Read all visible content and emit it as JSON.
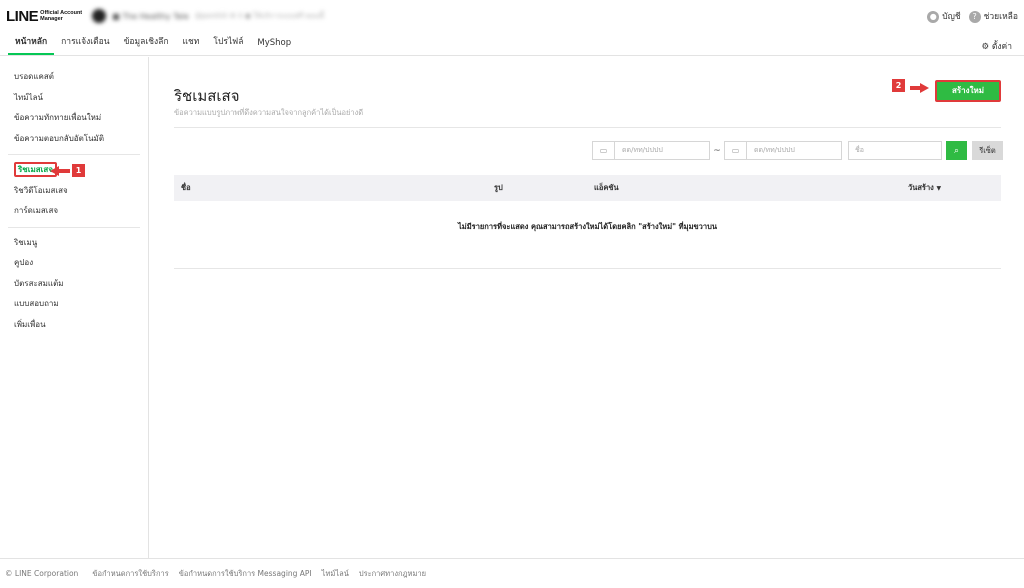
{
  "header": {
    "logo_main": "LINE",
    "logo_sub_1": "Official Account",
    "logo_sub_2": "Manager",
    "account_name": "■ The Healthy Tale",
    "account_meta": "@pontiiiii   ⚙ 0   ● ให้บริการแบบฟรี ตอนนี้",
    "account_label": "บัญชี",
    "help_label": "ช่วยเหลือ"
  },
  "nav": {
    "tabs": [
      "หน้าหลัก",
      "การแจ้งเตือน",
      "ข้อมูลเชิงลึก",
      "แชท",
      "โปรไฟล์",
      "MyShop"
    ],
    "active_index": 0,
    "settings_label": "ตั้งค่า"
  },
  "sidebar": {
    "group1": [
      "บรอดแคสต์",
      "ไทม์ไลน์",
      "ข้อความทักทายเพื่อนใหม่",
      "ข้อความตอบกลับอัตโนมัติ"
    ],
    "group2": [
      "ริชเมสเสจ",
      "ริชวิดีโอเมสเสจ",
      "การ์ดเมสเสจ"
    ],
    "group3": [
      "ริชเมนู",
      "คูปอง",
      "บัตรสะสมแต้ม",
      "แบบสอบถาม",
      "เพิ่มเพื่อน"
    ],
    "highlighted": "ริชเมสเสจ"
  },
  "callouts": {
    "first": "1",
    "second": "2"
  },
  "main": {
    "title": "ริชเมสเสจ",
    "description": "ข้อความแบบรูปภาพที่ดึงความสนใจจากลูกค้าได้เป็นอย่างดี",
    "create_label": "สร้างใหม่",
    "date_placeholder_from": "ดด/ทท/ปปปป",
    "date_placeholder_to": "ดด/ทท/ปปปป",
    "tilde": "~",
    "name_placeholder": "ชื่อ",
    "reset_label": "รีเซ็ต",
    "columns": [
      "ชื่อ",
      "รูป",
      "แอ็คชัน",
      "วันสร้าง"
    ],
    "sort_indicator": "▼",
    "empty_message": "ไม่มีรายการที่จะแสดง คุณสามารถสร้างใหม่ได้โดยคลิก \"สร้างใหม่\" ที่มุมขวาบน"
  },
  "footer": {
    "copyright": "© LINE Corporation",
    "links": [
      "ข้อกำหนดการใช้บริการ",
      "ข้อกำหนดการใช้บริการ Messaging API",
      "ไทม์ไลน์",
      "ประกาศทางกฎหมาย"
    ]
  },
  "colors": {
    "accent": "#06c755",
    "button_green": "#2fbb43",
    "annotation_red": "#e03a3a"
  }
}
